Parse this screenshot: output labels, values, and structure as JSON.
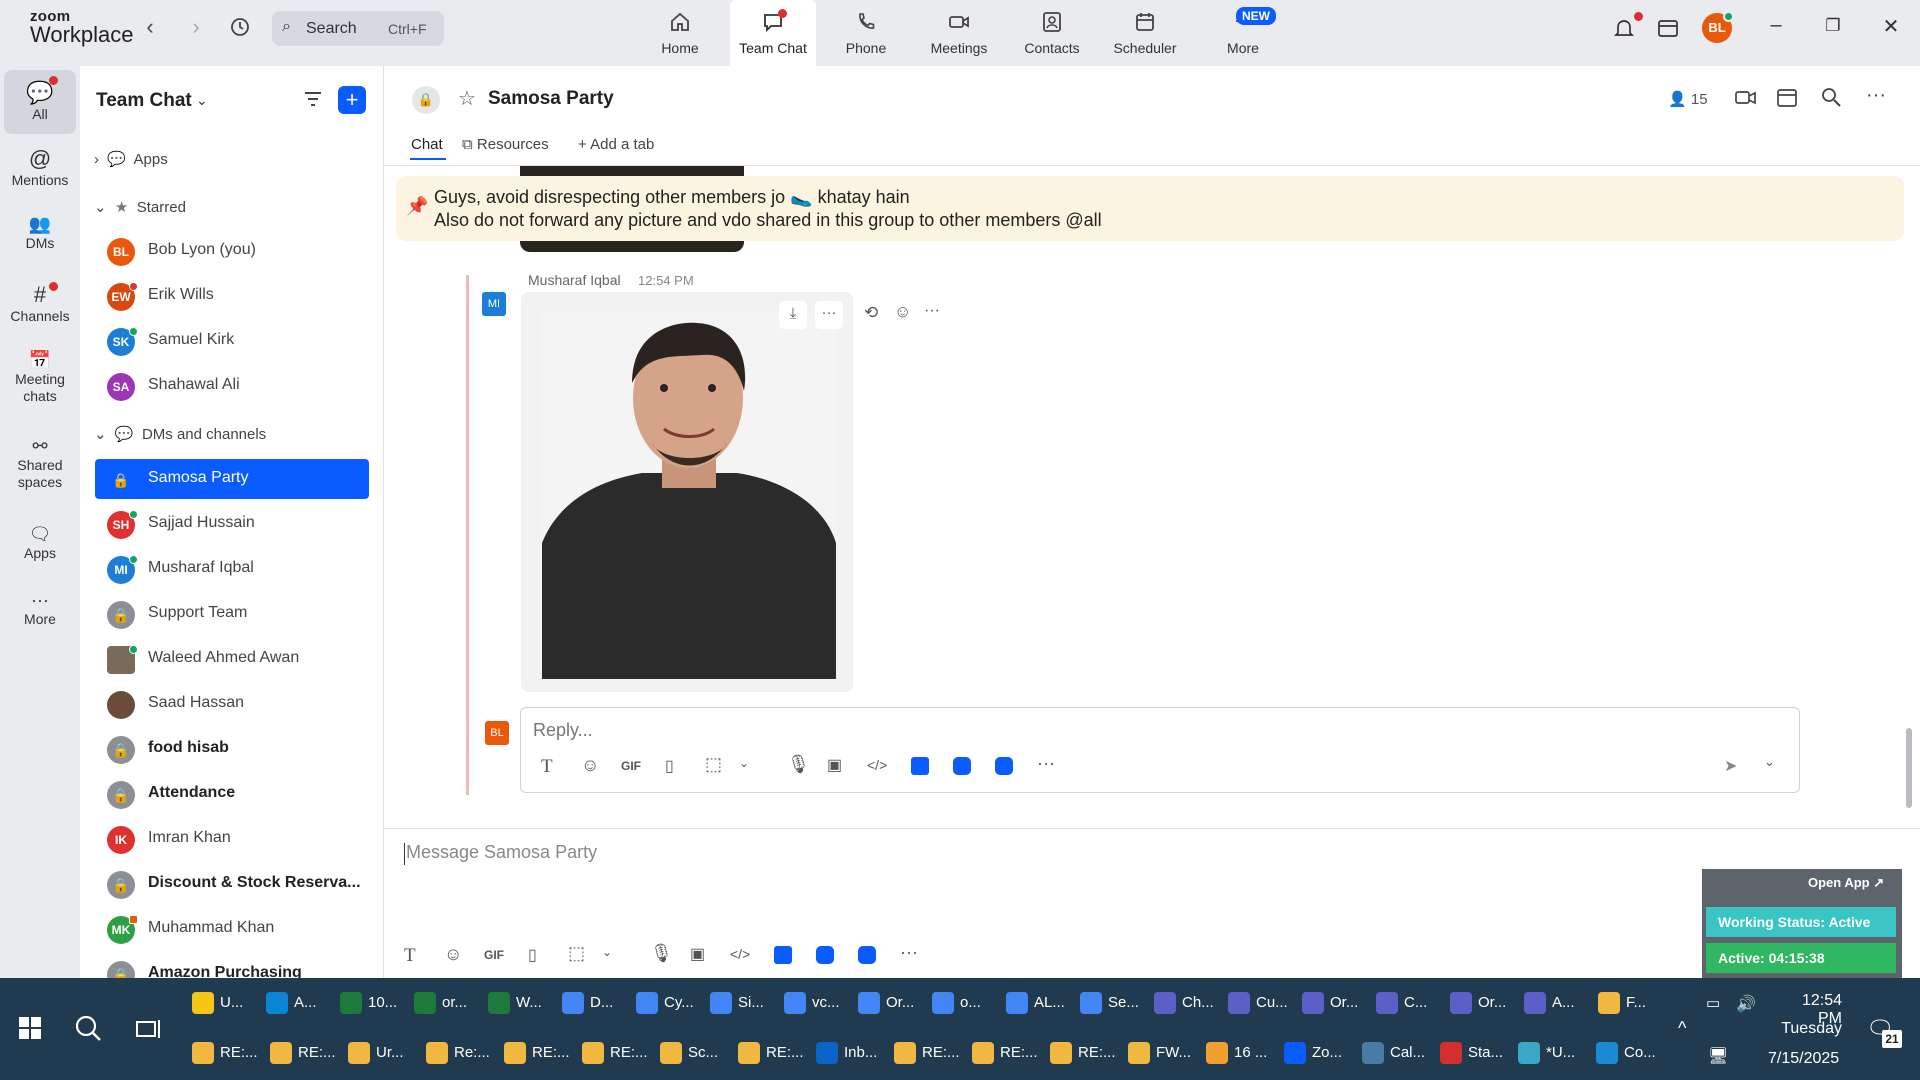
{
  "app": {
    "logo_top": "zoom",
    "logo_bottom": "Workplace"
  },
  "search": {
    "label": "Search",
    "shortcut": "Ctrl+F"
  },
  "topnav": [
    {
      "label": "Home",
      "icon": "home-icon"
    },
    {
      "label": "Team Chat",
      "icon": "chat-icon"
    },
    {
      "label": "Phone",
      "icon": "phone-icon"
    },
    {
      "label": "Meetings",
      "icon": "video-icon"
    },
    {
      "label": "Contacts",
      "icon": "contacts-icon"
    },
    {
      "label": "Scheduler",
      "icon": "calendar-icon"
    },
    {
      "label": "More",
      "icon": "more-icon"
    }
  ],
  "new_badge": "NEW",
  "user_avatar": {
    "initials": "BL",
    "color": "#e8590c"
  },
  "rail": [
    {
      "label": "All",
      "icon": "chat-bubble-icon"
    },
    {
      "label": "Mentions",
      "icon": "at-icon"
    },
    {
      "label": "DMs",
      "icon": "people-icon"
    },
    {
      "label": "Channels",
      "icon": "hash-icon"
    },
    {
      "label": "Meeting chats",
      "icon": "calendar-icon"
    },
    {
      "label": "Shared spaces",
      "icon": "share-icon"
    },
    {
      "label": "Apps",
      "icon": "apps-icon"
    },
    {
      "label": "More",
      "icon": "more-icon"
    }
  ],
  "sidebar": {
    "title": "Team Chat",
    "apps": "Apps",
    "starred": "Starred",
    "dms_channels": "DMs and channels",
    "starred_items": [
      {
        "name": "Bob Lyon (you)",
        "initials": "BL",
        "color": "#e8590c"
      },
      {
        "name": "Erik Wills",
        "initials": "EW",
        "color": "#d9480f"
      },
      {
        "name": "Samuel Kirk",
        "initials": "SK",
        "color": "#1c7ed6"
      },
      {
        "name": "Shahawal Ali",
        "initials": "SA",
        "color": "#9c36b5"
      }
    ],
    "dm_items": [
      {
        "name": "Samosa Party",
        "type": "lock"
      },
      {
        "name": "Sajjad Hussain",
        "initials": "SH",
        "color": "#e03131"
      },
      {
        "name": "Musharaf Iqbal",
        "initials": "MI",
        "color": "#1c7ed6"
      },
      {
        "name": "Support Team",
        "type": "lock"
      },
      {
        "name": "Waleed Ahmed Awan",
        "initials": "",
        "color": "#7a6a5a"
      },
      {
        "name": "Saad Hassan",
        "initials": "",
        "color": "#6b4b3b"
      },
      {
        "name": "food hisab",
        "type": "lock",
        "bold": true
      },
      {
        "name": "Attendance",
        "type": "lock",
        "bold": true
      },
      {
        "name": "Imran Khan",
        "initials": "IK",
        "color": "#e03131"
      },
      {
        "name": "Discount & Stock Reserva...",
        "type": "lock",
        "bold": true
      },
      {
        "name": "Muhammad Khan",
        "initials": "MK",
        "color": "#2f9e44"
      },
      {
        "name": "Amazon Purchasing",
        "type": "lock",
        "bold": true
      }
    ]
  },
  "channel": {
    "title": "Samosa Party",
    "members": "15",
    "tabs": [
      "Chat",
      "Resources",
      "Add a tab"
    ]
  },
  "pinned": {
    "line1": "Guys, avoid disrespecting other members jo 🥿 khatay hain",
    "line2": "Also do not forward any picture and vdo shared in this group to other members @all"
  },
  "message": {
    "author": "Musharaf Iqbal",
    "time": "12:54 PM",
    "initials": "MI"
  },
  "reply": {
    "placeholder": "Reply...",
    "avatar": "BL"
  },
  "composer": {
    "placeholder": "Message Samosa Party"
  },
  "toolbar": {
    "gif": "GIF"
  },
  "widget": {
    "open_app": "Open App ↗",
    "status": "Working Status: Active",
    "active": "Active: 04:15:38"
  },
  "taskbar": {
    "row1": [
      {
        "label": "U...",
        "color": "#f5c518"
      },
      {
        "label": "A...",
        "color": "#0a84d6"
      },
      {
        "label": "10...",
        "color": "#1d7a3c"
      },
      {
        "label": "or...",
        "color": "#1d7a3c"
      },
      {
        "label": "W...",
        "color": "#1d7a3c"
      },
      {
        "label": "D...",
        "color": "#4285f4"
      },
      {
        "label": "Cy...",
        "color": "#4285f4"
      },
      {
        "label": "Si...",
        "color": "#4285f4"
      },
      {
        "label": "vc...",
        "color": "#4285f4"
      },
      {
        "label": "Or...",
        "color": "#4285f4"
      },
      {
        "label": "o...",
        "color": "#4285f4"
      },
      {
        "label": "AL...",
        "color": "#4285f4"
      },
      {
        "label": "Se...",
        "color": "#4285f4"
      },
      {
        "label": "Ch...",
        "color": "#5b5fc7"
      },
      {
        "label": "Cu...",
        "color": "#5b5fc7"
      },
      {
        "label": "Or...",
        "color": "#5b5fc7"
      },
      {
        "label": "C...",
        "color": "#5b5fc7"
      },
      {
        "label": "Or...",
        "color": "#5b5fc7"
      },
      {
        "label": "A...",
        "color": "#5b5fc7"
      },
      {
        "label": "F...",
        "color": "#f0b840"
      }
    ],
    "row2": [
      {
        "label": "RE:...",
        "color": "#f0b840"
      },
      {
        "label": "RE:...",
        "color": "#f0b840"
      },
      {
        "label": "Ur...",
        "color": "#f0b840"
      },
      {
        "label": "Re:...",
        "color": "#f0b840"
      },
      {
        "label": "RE:...",
        "color": "#f0b840"
      },
      {
        "label": "RE:...",
        "color": "#f0b840"
      },
      {
        "label": "Sc...",
        "color": "#f0b840"
      },
      {
        "label": "RE:...",
        "color": "#f0b840"
      },
      {
        "label": "Inb...",
        "color": "#0a64c8"
      },
      {
        "label": "RE:...",
        "color": "#f0b840"
      },
      {
        "label": "RE:...",
        "color": "#f0b840"
      },
      {
        "label": "RE:...",
        "color": "#f0b840"
      },
      {
        "label": "FW...",
        "color": "#f0b840"
      },
      {
        "label": "16 ...",
        "color": "#f0a030"
      },
      {
        "label": "Zo...",
        "color": "#0b5cff"
      },
      {
        "label": "Cal...",
        "color": "#4a7ba6"
      },
      {
        "label": "Sta...",
        "color": "#d32f2f"
      },
      {
        "label": "*U...",
        "color": "#3aa7c6"
      },
      {
        "label": "Co...",
        "color": "#1b8ad4"
      }
    ],
    "time": "12:54 PM",
    "day": "Tuesday",
    "date": "7/15/2025",
    "notif_count": "21"
  }
}
